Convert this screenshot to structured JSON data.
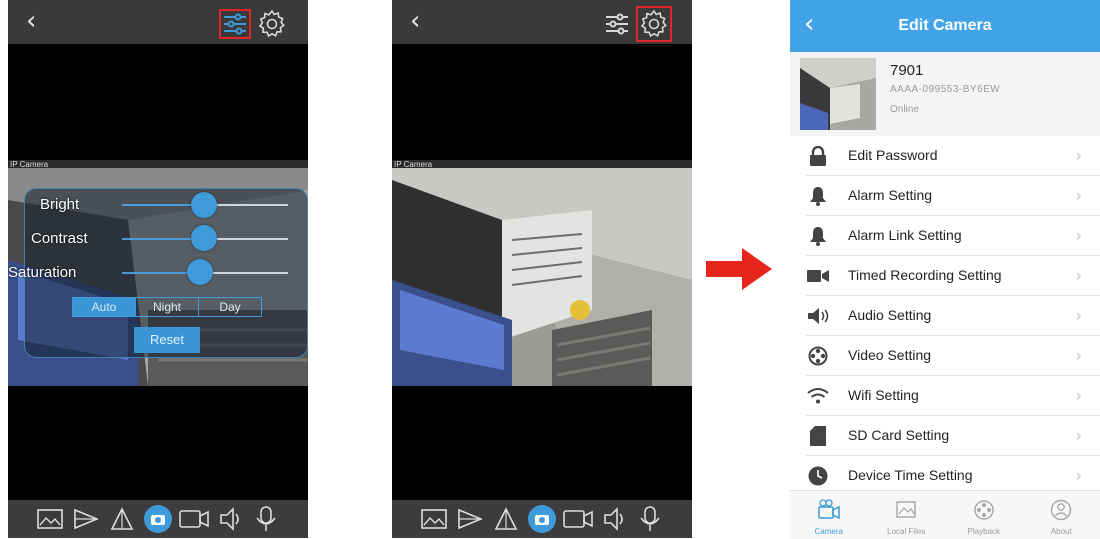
{
  "screen1": {
    "sliders": [
      {
        "label": "Bright",
        "level": 0.45
      },
      {
        "label": "Contrast",
        "level": 0.45
      },
      {
        "label": "Saturation",
        "level": 0.42
      }
    ],
    "modes": [
      "Auto",
      "Night",
      "Day"
    ],
    "selected_mode": "Auto",
    "reset_label": "Reset",
    "highlighted_control": "adjust-sliders-icon",
    "overlay_left": "IP Camera"
  },
  "screen2": {
    "highlighted_control": "gear-icon",
    "overlay_left": "IP Camera"
  },
  "edit_camera": {
    "title": "Edit Camera",
    "camera": {
      "name": "7901",
      "uid": "AAAA-099553-BY6EW",
      "status": "Online"
    },
    "menu": [
      {
        "label": "Edit Password",
        "icon": "lock-icon"
      },
      {
        "label": "Alarm Setting",
        "icon": "bell-icon"
      },
      {
        "label": "Alarm Link Setting",
        "icon": "bell-icon"
      },
      {
        "label": "Timed Recording Setting",
        "icon": "video-camera-icon"
      },
      {
        "label": "Audio Setting",
        "icon": "speaker-icon"
      },
      {
        "label": "Video Setting",
        "icon": "film-reel-icon"
      },
      {
        "label": "Wifi Setting",
        "icon": "wifi-icon"
      },
      {
        "label": "SD Card Setting",
        "icon": "sd-card-icon"
      },
      {
        "label": "Device Time Setting",
        "icon": "clock-icon"
      }
    ],
    "tabs": [
      {
        "label": "Camera",
        "active": true
      },
      {
        "label": "Local Files",
        "active": false
      },
      {
        "label": "Playback",
        "active": false
      },
      {
        "label": "About",
        "active": false
      }
    ]
  },
  "colors": {
    "accent": "#42a3e8",
    "highlight": "#e0262b",
    "arrow": "#e8251d"
  }
}
